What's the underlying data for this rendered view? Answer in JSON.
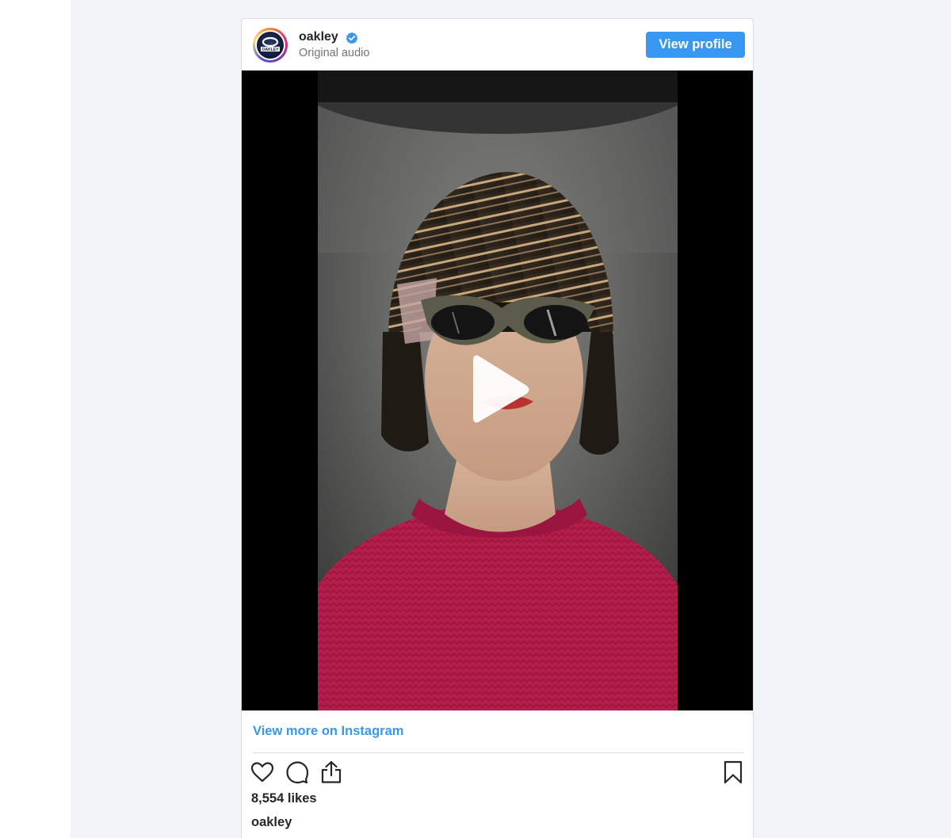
{
  "post": {
    "username": "oakley",
    "audio_label": "Original audio",
    "view_profile_label": "View profile",
    "view_more_label": "View more on Instagram",
    "likes": "8,554 likes",
    "caption_user": "oakley",
    "verified": true
  },
  "avatar": {
    "logo_text": "OAKLEY"
  },
  "colors": {
    "accent": "#3897f0",
    "text_primary": "#262626",
    "text_secondary": "#737373",
    "background": "#f1f4f8",
    "divider": "#dbdbdb"
  },
  "icons": {
    "verified": "verified-badge-icon",
    "play": "play-icon",
    "like": "heart-icon",
    "comment": "comment-icon",
    "share": "share-icon",
    "save": "bookmark-icon"
  }
}
